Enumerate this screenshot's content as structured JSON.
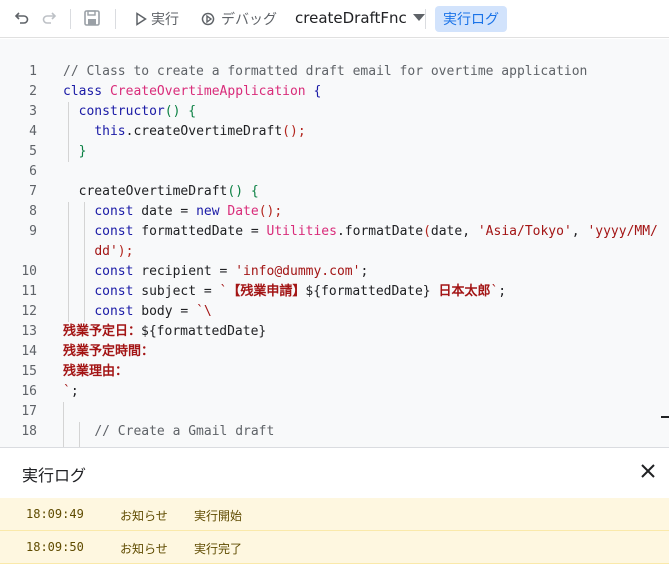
{
  "toolbar": {
    "undo_icon": "undo-icon",
    "redo_icon": "redo-icon",
    "save_icon": "save-icon",
    "run_label": "実行",
    "debug_label": "デバッグ",
    "function_name": "createDraftFnc",
    "log_toggle_label": "実行ログ"
  },
  "editor": {
    "lines": [
      {
        "n": "1",
        "tokens": [
          {
            "t": "// Class to create a formatted draft email for overtime application",
            "c": "comment"
          }
        ]
      },
      {
        "n": "2",
        "tokens": [
          {
            "t": "class ",
            "c": "kw"
          },
          {
            "t": "CreateOvertimeApplication",
            "c": "cls"
          },
          {
            "t": " {",
            "c": "kw"
          }
        ]
      },
      {
        "n": "3",
        "tokens": [
          {
            "t": "  ",
            "c": "pn"
          },
          {
            "t": "constructor",
            "c": "kw"
          },
          {
            "t": "() {",
            "c": "br"
          }
        ]
      },
      {
        "n": "4",
        "tokens": [
          {
            "t": "    ",
            "c": "pn"
          },
          {
            "t": "this",
            "c": "kw"
          },
          {
            "t": ".createOvertimeDraft",
            "c": "fn"
          },
          {
            "t": "();",
            "c": "br2"
          }
        ]
      },
      {
        "n": "5",
        "tokens": [
          {
            "t": "  }",
            "c": "br"
          }
        ]
      },
      {
        "n": "6",
        "tokens": []
      },
      {
        "n": "7",
        "tokens": [
          {
            "t": "  createOvertimeDraft",
            "c": "fn"
          },
          {
            "t": "() {",
            "c": "br"
          }
        ]
      },
      {
        "n": "8",
        "tokens": [
          {
            "t": "    ",
            "c": "pn"
          },
          {
            "t": "const",
            "c": "kw"
          },
          {
            "t": " date = ",
            "c": "pn"
          },
          {
            "t": "new",
            "c": "kw"
          },
          {
            "t": " ",
            "c": "pn"
          },
          {
            "t": "Date",
            "c": "cls"
          },
          {
            "t": "();",
            "c": "br2"
          }
        ]
      },
      {
        "n": "9",
        "tokens": [
          {
            "t": "    ",
            "c": "pn"
          },
          {
            "t": "const",
            "c": "kw"
          },
          {
            "t": " formattedDate = ",
            "c": "pn"
          },
          {
            "t": "Utilities",
            "c": "cls"
          },
          {
            "t": ".formatDate",
            "c": "fn"
          },
          {
            "t": "(",
            "c": "br2"
          },
          {
            "t": "date, ",
            "c": "pn"
          },
          {
            "t": "'Asia/Tokyo'",
            "c": "str"
          },
          {
            "t": ", ",
            "c": "pn"
          },
          {
            "t": "'yyyy/MM/",
            "c": "str"
          }
        ]
      },
      {
        "n": "",
        "tokens": [
          {
            "t": "    ",
            "c": "pn"
          },
          {
            "t": "dd'",
            "c": "str"
          },
          {
            "t": ");",
            "c": "br2"
          }
        ]
      },
      {
        "n": "10",
        "tokens": [
          {
            "t": "    ",
            "c": "pn"
          },
          {
            "t": "const",
            "c": "kw"
          },
          {
            "t": " recipient = ",
            "c": "pn"
          },
          {
            "t": "'info@dummy.com'",
            "c": "str"
          },
          {
            "t": ";",
            "c": "pn"
          }
        ]
      },
      {
        "n": "11",
        "tokens": [
          {
            "t": "    ",
            "c": "pn"
          },
          {
            "t": "const",
            "c": "kw"
          },
          {
            "t": " subject = ",
            "c": "pn"
          },
          {
            "t": "`",
            "c": "str"
          },
          {
            "t": "【残業申請】",
            "c": "jp"
          },
          {
            "t": "${formattedDate}",
            "c": "pn"
          },
          {
            "t": " ",
            "c": "pn"
          },
          {
            "t": "日本太郎",
            "c": "jp"
          },
          {
            "t": "`",
            "c": "str"
          },
          {
            "t": ";",
            "c": "pn"
          }
        ]
      },
      {
        "n": "12",
        "tokens": [
          {
            "t": "    ",
            "c": "pn"
          },
          {
            "t": "const",
            "c": "kw"
          },
          {
            "t": " body = ",
            "c": "pn"
          },
          {
            "t": "`\\",
            "c": "str"
          }
        ]
      },
      {
        "n": "13",
        "tokens": [
          {
            "t": "残業予定日：",
            "c": "jp"
          },
          {
            "t": "${formattedDate}",
            "c": "pn"
          }
        ]
      },
      {
        "n": "14",
        "tokens": [
          {
            "t": "残業予定時間：",
            "c": "jp"
          }
        ]
      },
      {
        "n": "15",
        "tokens": [
          {
            "t": "残業理由：",
            "c": "jp"
          }
        ]
      },
      {
        "n": "16",
        "tokens": [
          {
            "t": "`",
            "c": "str"
          },
          {
            "t": ";",
            "c": "pn"
          }
        ]
      },
      {
        "n": "17",
        "tokens": []
      },
      {
        "n": "18",
        "tokens": [
          {
            "t": "    ",
            "c": "pn"
          },
          {
            "t": "// Create a Gmail draft",
            "c": "comment"
          }
        ]
      }
    ]
  },
  "log": {
    "title": "実行ログ",
    "close_icon": "close-icon",
    "entries": [
      {
        "time": "18:09:49",
        "level": "お知らせ",
        "message": "実行開始"
      },
      {
        "time": "18:09:50",
        "level": "お知らせ",
        "message": "実行完了"
      }
    ]
  }
}
